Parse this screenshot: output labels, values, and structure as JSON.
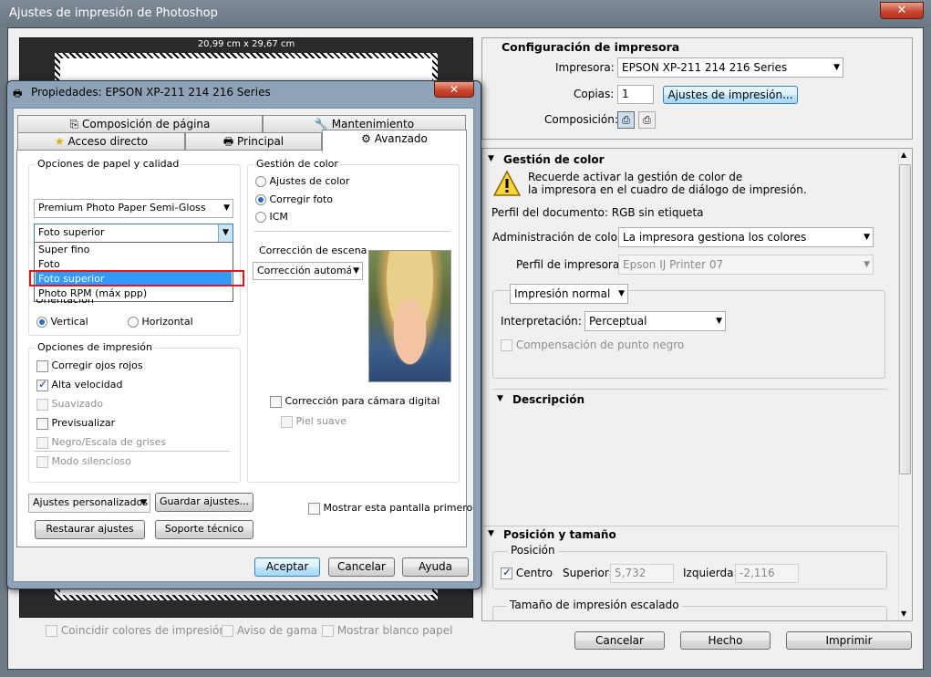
{
  "window": {
    "title": "Ajustes de impresión de Photoshop",
    "close": "✕"
  },
  "preview": {
    "paper_size": "20,99 cm x 29,67 cm",
    "checkboxes": [
      {
        "label": "Coincidir colores de impresión",
        "checked": false
      },
      {
        "label": "Aviso de gama",
        "checked": false
      },
      {
        "label": "Mostrar blanco papel",
        "checked": false
      }
    ]
  },
  "printer_config": {
    "heading": "Configuración de impresora",
    "printer_label": "Impresora:",
    "printer_value": "EPSON XP-211 214 216 Series",
    "copies_label": "Copias:",
    "copies_value": "1",
    "print_settings_button": "Ajustes de impresión...",
    "layout_label": "Composición:"
  },
  "color_management": {
    "heading": "Gestión de color",
    "warning_text_1": "Recuerde activar la gestión de color de",
    "warning_text_2": "la impresora en el cuadro de diálogo de impresión.",
    "doc_profile": "Perfil del documento: RGB sin etiqueta",
    "admin_label": "Administración de color:",
    "admin_value": "La impresora gestiona los colores",
    "printer_profile_label": "Perfil de impresora:",
    "printer_profile_value": "Epson IJ Printer 07",
    "normal_print_value": "Impresión normal",
    "interpretation_label": "Interpretación:",
    "interpretation_value": "Perceptual",
    "black_point_label": "Compensación de punto negro"
  },
  "description": {
    "heading": "Descripción"
  },
  "position": {
    "heading": "Posición y tamaño",
    "group": "Posición",
    "center_label": "Centro",
    "top_label": "Superior:",
    "top_value": "5,732",
    "left_label": "Izquierda:",
    "left_value": "-2,116",
    "scaled_heading": "Tamaño de impresión escalado"
  },
  "bottom_buttons": {
    "cancel": "Cancelar",
    "done": "Hecho",
    "print": "Imprimir"
  },
  "dialog": {
    "title": "Propiedades: EPSON XP-211 214 216 Series",
    "close": "✕",
    "tabs_back": [
      "Composición de página",
      "Mantenimiento"
    ],
    "tabs_front": [
      "Acceso directo",
      "Principal",
      "Avanzado"
    ],
    "paper_group": "Opciones de papel y calidad",
    "paper_value": "Premium Photo Paper Semi-Gloss",
    "quality_value": "Foto superior",
    "quality_options": [
      "Super fino",
      "Foto",
      "Foto superior",
      "Photo RPM (máx ppp)"
    ],
    "quality_selected_index": 2,
    "orientation_label": "Orientación",
    "orientation_vertical": "Vertical",
    "orientation_horizontal": "Horizontal",
    "print_options_group": "Opciones de impresión",
    "print_options": [
      {
        "label": "Corregir ojos rojos",
        "checked": false,
        "enabled": true
      },
      {
        "label": "Alta velocidad",
        "checked": true,
        "enabled": true
      },
      {
        "label": "Suavizado",
        "checked": false,
        "enabled": false
      },
      {
        "label": "Previsualizar",
        "checked": false,
        "enabled": true
      },
      {
        "label": "Negro/Escala de grises",
        "checked": false,
        "enabled": false
      },
      {
        "label": "Modo silencioso",
        "checked": false,
        "enabled": false
      }
    ],
    "color_group": "Gestión de color",
    "color_options": [
      {
        "label": "Ajustes de color",
        "selected": false
      },
      {
        "label": "Corregir foto",
        "selected": true
      },
      {
        "label": "ICM",
        "selected": false
      }
    ],
    "scene_label": "Corrección de escena",
    "scene_value": "Corrección automáti",
    "digital_camera_label": "Corrección para cámara digital",
    "smooth_skin_label": "Piel suave",
    "custom_settings_value": "Ajustes personalizados",
    "save_settings_button": "Guardar ajustes...",
    "show_first_label": "Mostrar esta pantalla primero",
    "restore_button": "Restaurar ajustes",
    "support_button": "Soporte técnico",
    "ok_button": "Aceptar",
    "cancel_button": "Cancelar",
    "help_button": "Ayuda"
  }
}
